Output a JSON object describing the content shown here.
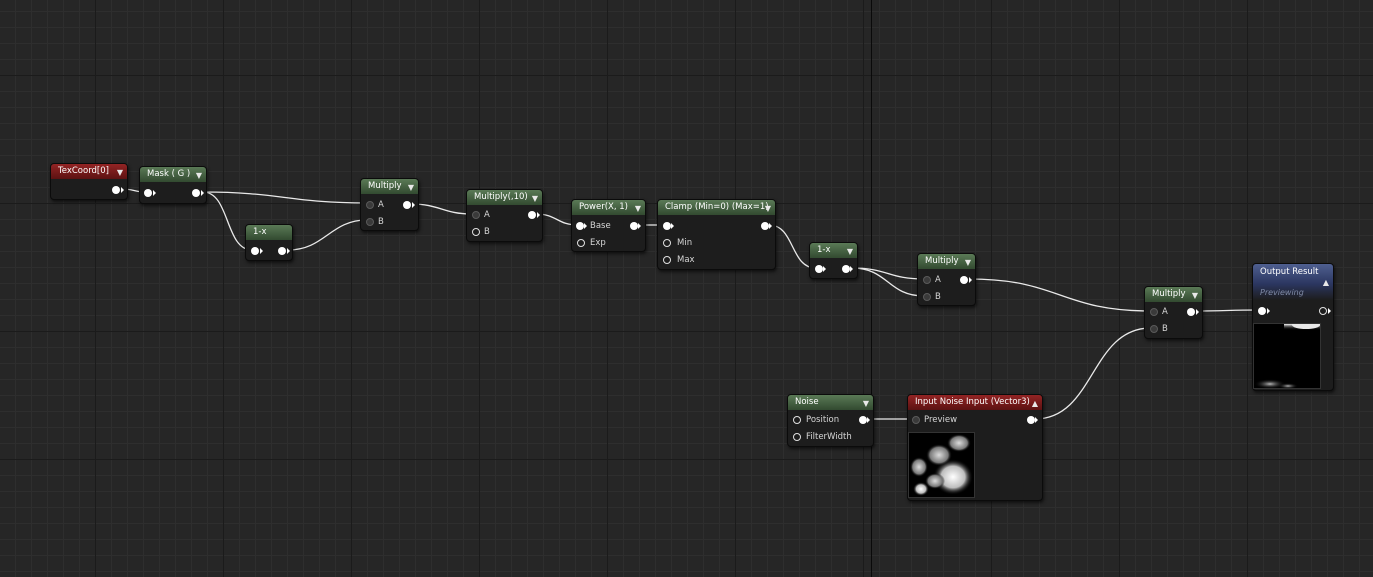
{
  "nodes": {
    "texcoord": {
      "title": "TexCoord[0]"
    },
    "mask": {
      "title": "Mask ( G )"
    },
    "one_minus_1": {
      "title": "1-x"
    },
    "multiply_1": {
      "title": "Multiply",
      "pin_a": "A",
      "pin_b": "B"
    },
    "multiply_10": {
      "title": "Multiply(,10)",
      "pin_a": "A",
      "pin_b": "B"
    },
    "power": {
      "title": "Power(X, 1)",
      "pin_base": "Base",
      "pin_exp": "Exp"
    },
    "clamp": {
      "title": "Clamp (Min=0) (Max=1)",
      "pin_min": "Min",
      "pin_max": "Max"
    },
    "one_minus_2": {
      "title": "1-x"
    },
    "multiply_2": {
      "title": "Multiply",
      "pin_a": "A",
      "pin_b": "B"
    },
    "multiply_3": {
      "title": "Multiply",
      "pin_a": "A",
      "pin_b": "B"
    },
    "noise": {
      "title": "Noise",
      "pin_position": "Position",
      "pin_filterwidth": "FilterWidth"
    },
    "input_noise": {
      "title": "Input Noise Input (Vector3)",
      "pin_preview": "Preview"
    },
    "output": {
      "title": "Output Result",
      "subtitle": "Previewing"
    }
  },
  "icons": {
    "collapse": "chevron-down-icon",
    "expand": "chevron-up-icon",
    "pin": "pin-circle-icon"
  },
  "colors": {
    "graph_background": "#262626",
    "function_header": "#4a6a46",
    "input_header": "#7a1c1c",
    "output_header": "#3e4c7a",
    "wire": "#ffffff"
  }
}
